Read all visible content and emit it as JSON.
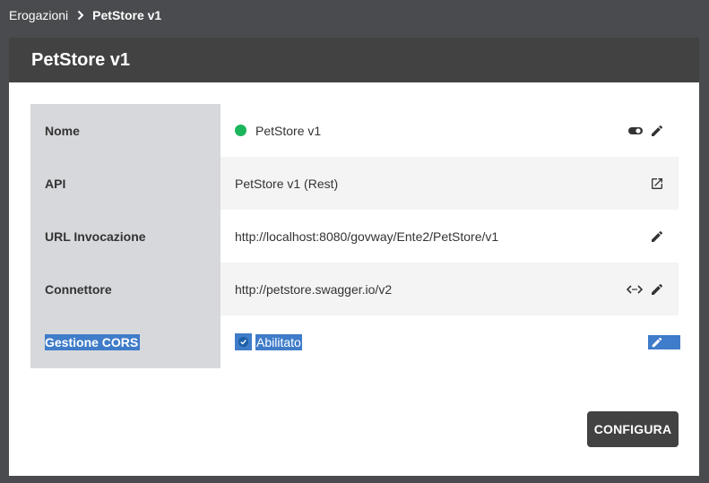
{
  "breadcrumb": {
    "parent": "Erogazioni",
    "current": "PetStore v1"
  },
  "card": {
    "title": "PetStore v1"
  },
  "rows": [
    {
      "label": "Nome",
      "value": "PetStore v1",
      "status_color": "#1bb55c",
      "icons": [
        "toggle-icon",
        "edit-icon"
      ]
    },
    {
      "label": "API",
      "value": "PetStore v1 (Rest)",
      "icons": [
        "open-in-new-icon"
      ]
    },
    {
      "label": "URL Invocazione",
      "value": "http://localhost:8080/govway/Ente2/PetStore/v1",
      "icons": [
        "edit-icon"
      ]
    },
    {
      "label": "Connettore",
      "value": "http://petstore.swagger.io/v2",
      "icons": [
        "code-arrows-icon",
        "edit-icon"
      ]
    },
    {
      "label": "Gestione CORS",
      "value": "Abilitato",
      "icons": [
        "check-circle-icon",
        "edit-icon"
      ]
    }
  ],
  "actions": {
    "configure_label": "CONFIGURA"
  },
  "colors": {
    "header": "#424242",
    "label_bg": "#d7d8dc",
    "selection": "#3f7cc9",
    "status_ok": "#1bb55c"
  }
}
